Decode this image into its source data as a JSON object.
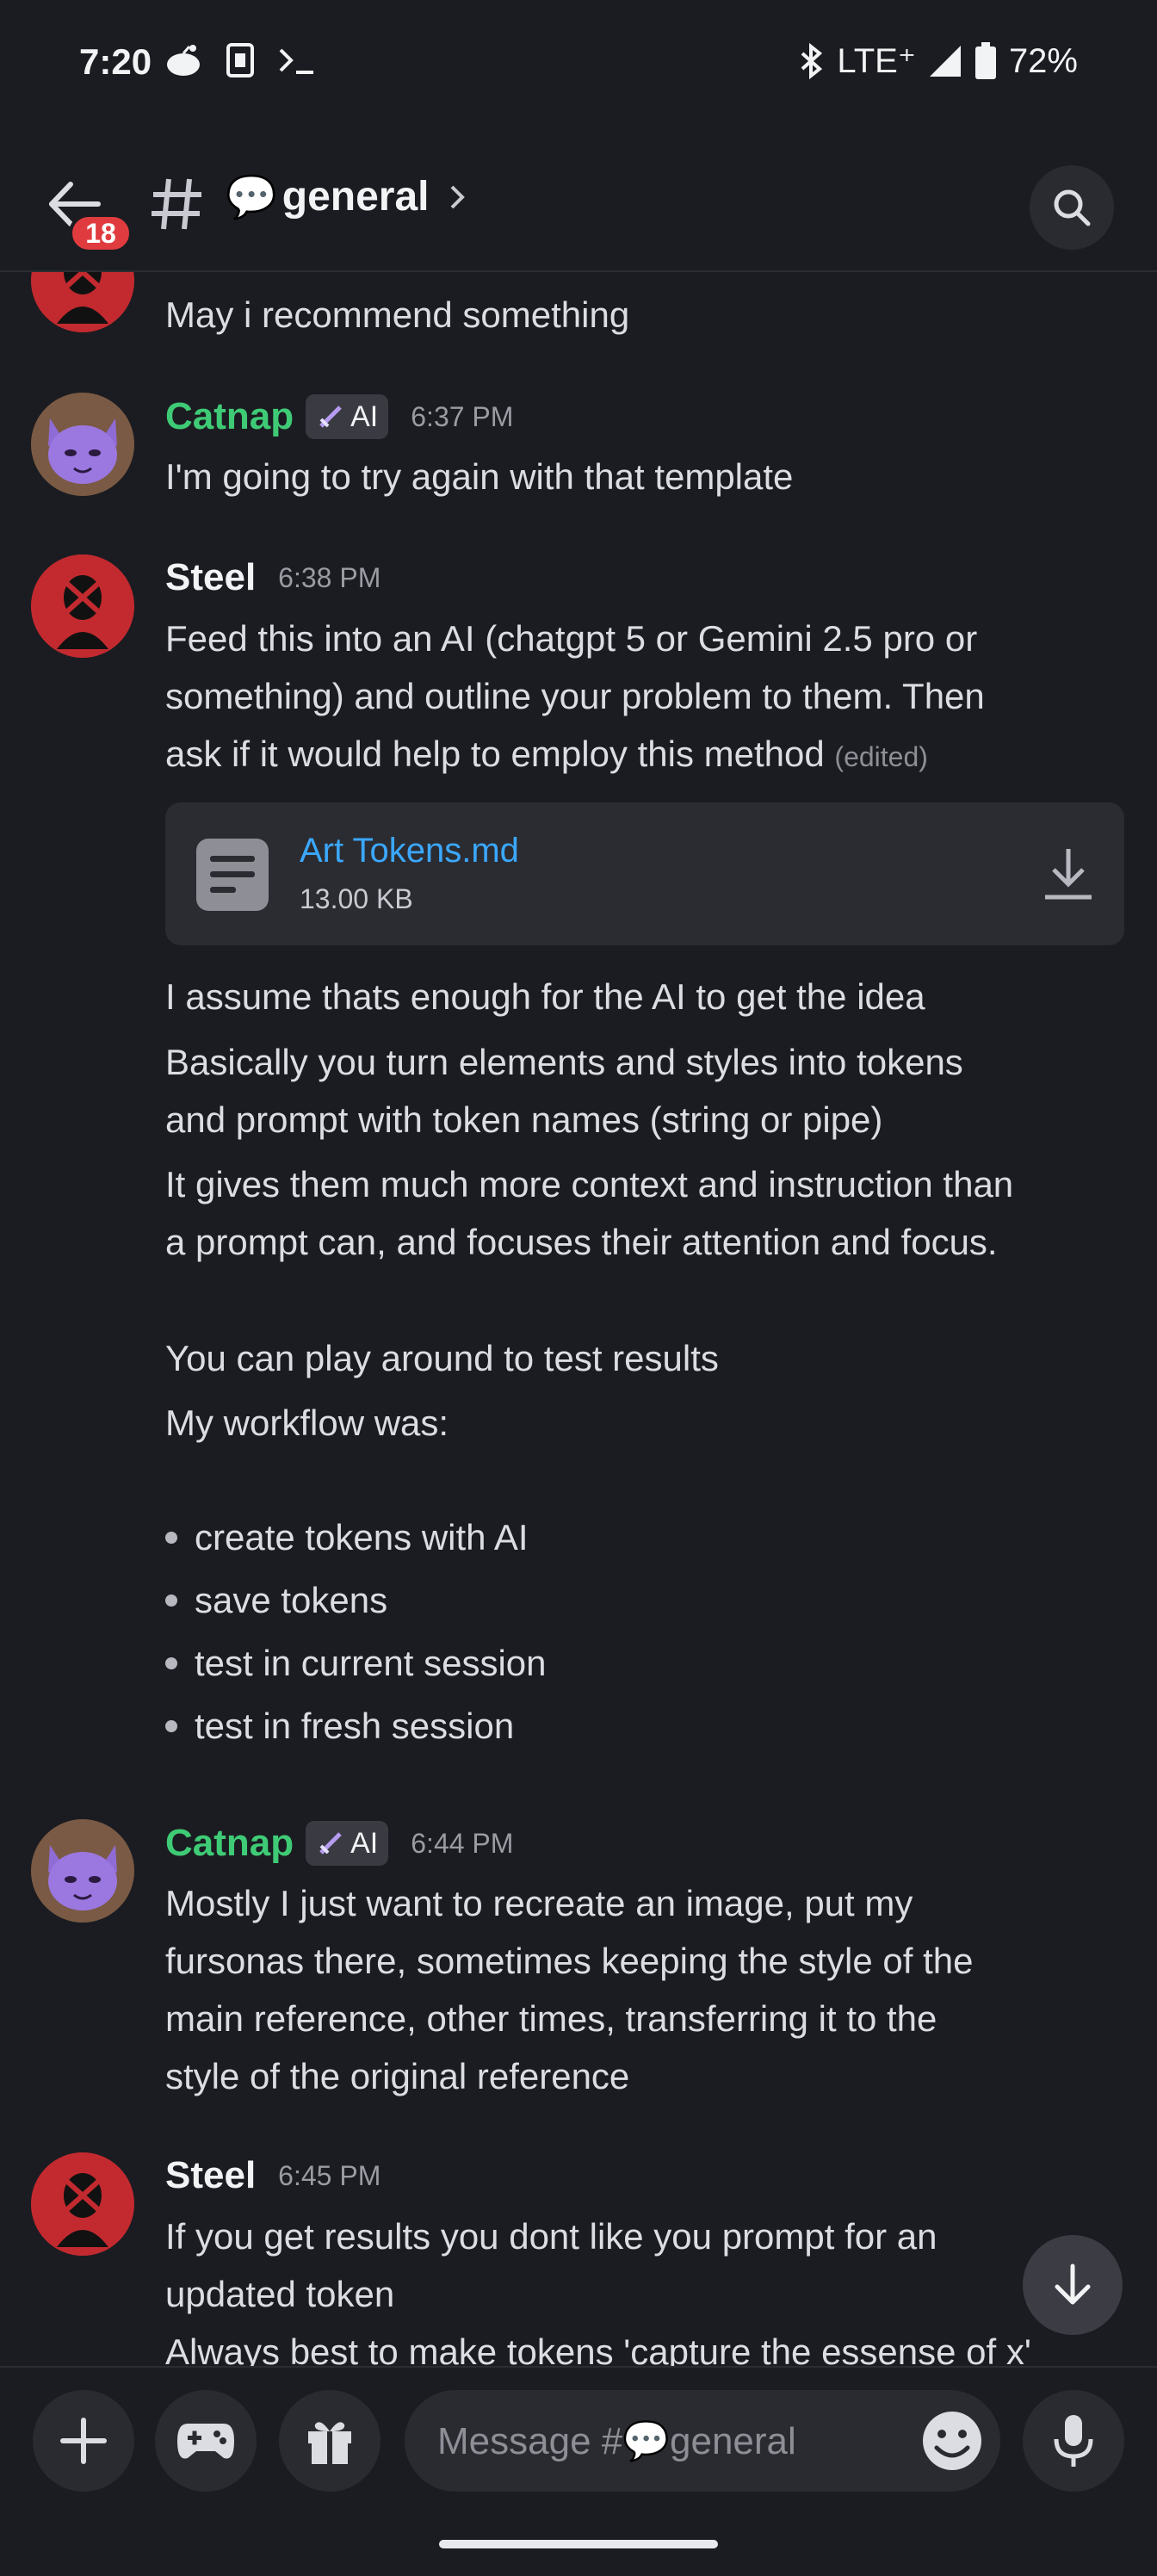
{
  "status_bar": {
    "time": "7:20",
    "network": "LTE⁺",
    "battery": "72%"
  },
  "header": {
    "back_badge": "18",
    "channel_emoji": "💬",
    "channel_name": "general"
  },
  "messages": {
    "m0": {
      "text": "May i recommend something"
    },
    "m1": {
      "author": "Catnap",
      "tag": "AI",
      "time": "6:37 PM",
      "text": "I'm going to try again with that template"
    },
    "m2": {
      "author": "Steel",
      "time": "6:38 PM",
      "line1": "Feed this into an AI (chatgpt 5 or Gemini 2.5 pro or",
      "line2": "something) and outline your problem to them. Then",
      "line3": "ask if it would help to employ this method",
      "edited": "(edited)",
      "attachment": {
        "name": "Art Tokens.md",
        "size": "13.00 KB"
      },
      "p1": "I assume thats enough for the AI to get the idea",
      "p2a": "Basically you turn elements and styles into tokens",
      "p2b": "and prompt with token names (string or pipe)",
      "p3a": "It gives them much more context and instruction than",
      "p3b": "a prompt can, and focuses their attention and focus.",
      "p4": "You can play around to test results",
      "p5": "My workflow was:",
      "bullets": [
        "create tokens with AI",
        "save tokens",
        "test in current session",
        "test in fresh session"
      ]
    },
    "m3": {
      "author": "Catnap",
      "tag": "AI",
      "time": "6:44 PM",
      "l1": "Mostly I just want to recreate an image, put my",
      "l2": "fursonas there, sometimes keeping the style of the",
      "l3": "main reference, other times, transferring it to the",
      "l4": "style of the original reference"
    },
    "m4": {
      "author": "Steel",
      "time": "6:45 PM",
      "l1": "If you get results you dont like you prompt for an",
      "l2": "updated token",
      "l3": "Always best to make tokens 'capture the essense of x'"
    }
  },
  "composer": {
    "placeholder": "Message #💬general"
  },
  "colors": {
    "background": "#1b1c21",
    "green_name": "#3fcb76",
    "link_blue": "#3ba8ff",
    "badge_red": "#e03c3f"
  }
}
